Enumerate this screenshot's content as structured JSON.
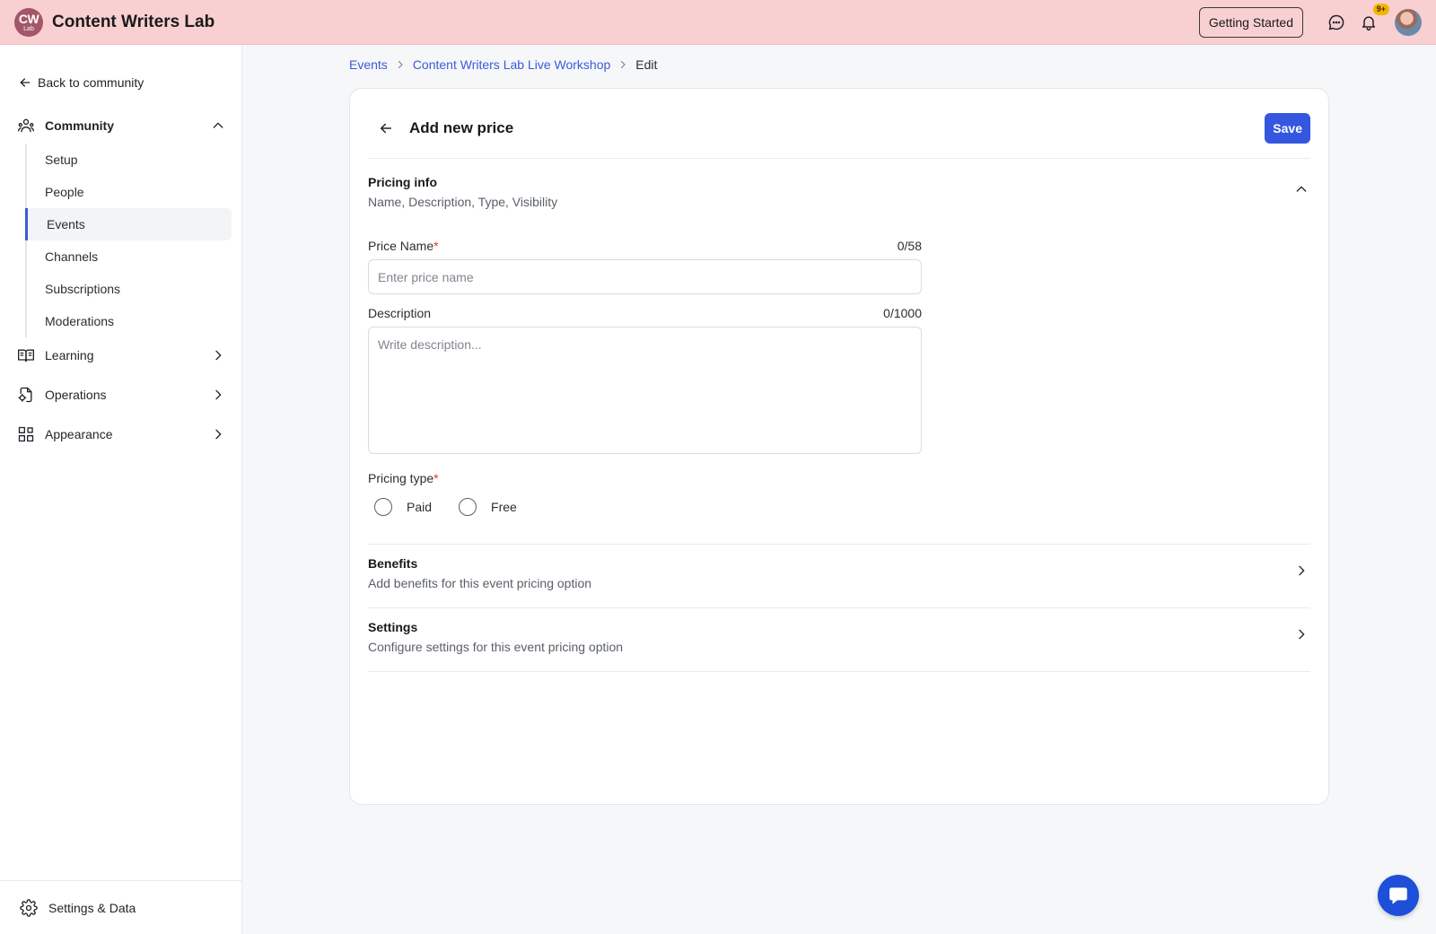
{
  "app": {
    "logo_line1": "CW",
    "logo_line2": "Lab",
    "title": "Content Writers Lab"
  },
  "topbar": {
    "getting_started_label": "Getting Started",
    "notifications_badge": "9+"
  },
  "sidebar": {
    "back_label": "Back to community",
    "community_label": "Community",
    "community_items": [
      {
        "label": "Setup"
      },
      {
        "label": "People"
      },
      {
        "label": "Events"
      },
      {
        "label": "Channels"
      },
      {
        "label": "Subscriptions"
      },
      {
        "label": "Moderations"
      }
    ],
    "learning_label": "Learning",
    "operations_label": "Operations",
    "appearance_label": "Appearance",
    "footer_label": "Settings & Data"
  },
  "breadcrumb": {
    "items": [
      "Events",
      "Content Writers Lab Live Workshop",
      "Edit"
    ]
  },
  "card": {
    "title": "Add new price",
    "save_label": "Save",
    "pricing_info": {
      "title": "Pricing info",
      "subtitle": "Name, Description, Type, Visibility"
    },
    "price_name": {
      "label": "Price Name",
      "required_mark": "*",
      "count": "0/58",
      "value": "",
      "placeholder": "Enter price name"
    },
    "description": {
      "label": "Description",
      "count": "0/1000",
      "value": "",
      "placeholder": "Write description..."
    },
    "pricing_type": {
      "label": "Pricing type",
      "required_mark": "*",
      "options": [
        "Paid",
        "Free"
      ]
    },
    "benefits": {
      "title": "Benefits",
      "subtitle": "Add benefits for this event pricing option"
    },
    "settings": {
      "title": "Settings",
      "subtitle": "Configure settings for this event pricing option"
    }
  },
  "colors": {
    "topbar_bg": "#f8d0d2",
    "accent": "#3557e0",
    "logo_bg": "#a4566a",
    "chat_fab": "#1d4fd8",
    "badge": "#f5b400"
  }
}
